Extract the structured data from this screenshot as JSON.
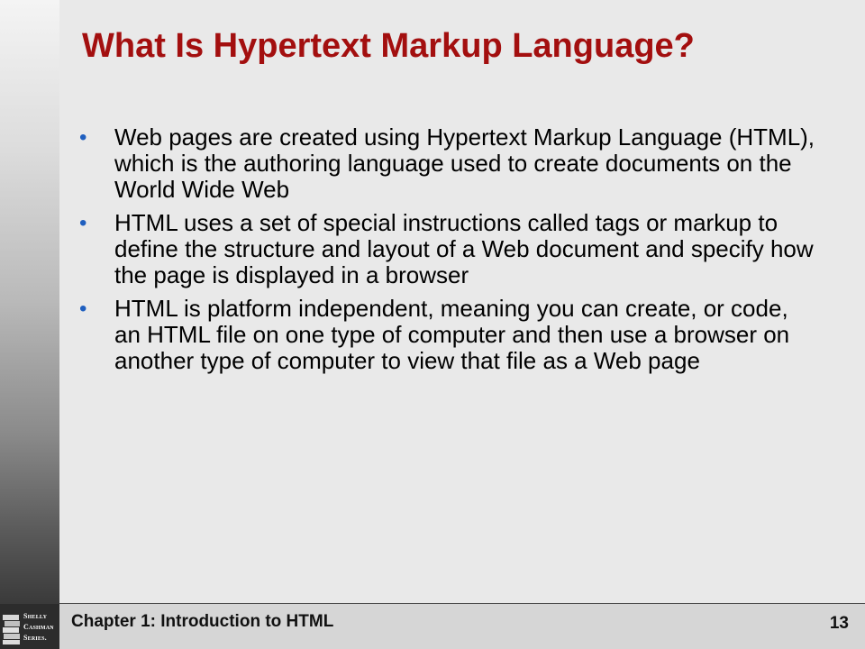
{
  "slide": {
    "title": "What Is Hypertext Markup Language?",
    "bullet_symbol": "•",
    "bullets": [
      "Web pages are created using Hypertext Markup Language (HTML), which is the authoring language used to create documents on the World Wide Web",
      "HTML uses a set of special instructions called tags or markup to define the structure and layout of a Web document and specify how the page is displayed in a browser",
      "HTML is platform independent, meaning you can create, or code, an HTML file on one type of computer and then use a browser on another type of computer to view that file as a Web page"
    ]
  },
  "footer": {
    "chapter": "Chapter 1: Introduction to HTML",
    "page_number": "13"
  },
  "logo": {
    "lines": [
      "Shelly",
      "Cashman",
      "Series."
    ]
  },
  "colors": {
    "title": "#a30f0f",
    "bullet": "#1f5fbf",
    "background": "#e9e9e9"
  }
}
